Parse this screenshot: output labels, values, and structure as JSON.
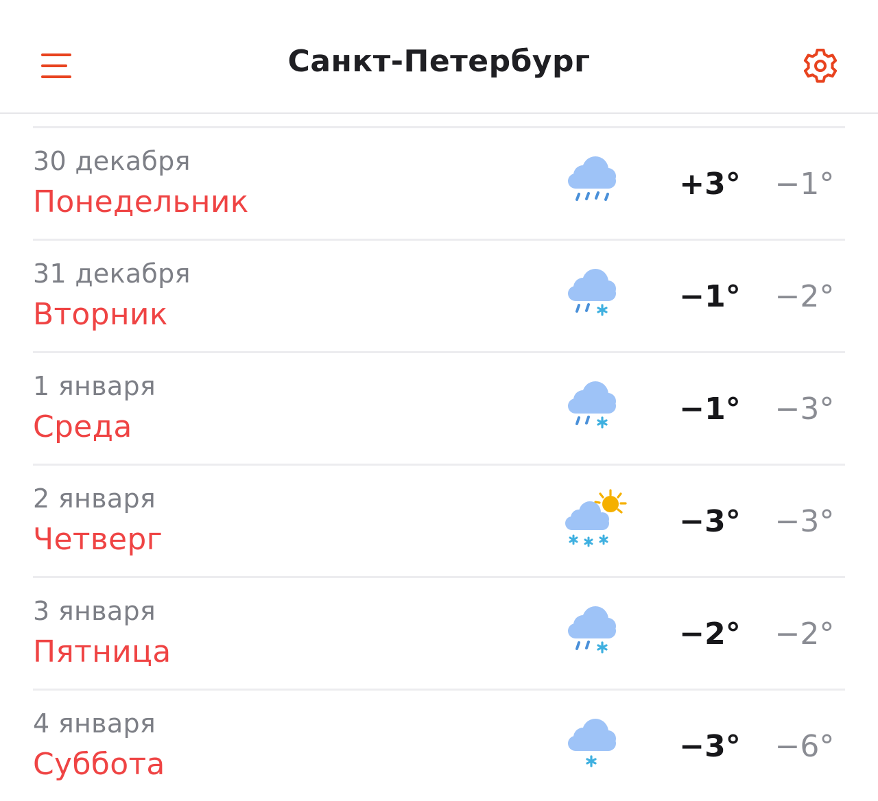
{
  "header": {
    "title": "Санкт-Петербург",
    "menu_icon": "hamburger-menu-icon",
    "settings_icon": "gear-icon",
    "accent_color": "#e8431f"
  },
  "forecast": [
    {
      "date": "30 декабря",
      "weekday": "Понедельник",
      "icon": "cloud-rain-icon",
      "day_temp": "+3°",
      "night_temp": "−1°"
    },
    {
      "date": "31 декабря",
      "weekday": "Вторник",
      "icon": "cloud-rain-snow-icon",
      "day_temp": "−1°",
      "night_temp": "−2°"
    },
    {
      "date": "1 января",
      "weekday": "Среда",
      "icon": "cloud-rain-snow-icon",
      "day_temp": "−1°",
      "night_temp": "−3°"
    },
    {
      "date": "2 января",
      "weekday": "Четверг",
      "icon": "sun-cloud-snow-icon",
      "day_temp": "−3°",
      "night_temp": "−3°"
    },
    {
      "date": "3 января",
      "weekday": "Пятница",
      "icon": "cloud-rain-snow-icon",
      "day_temp": "−2°",
      "night_temp": "−2°"
    },
    {
      "date": "4 января",
      "weekday": "Суббота",
      "icon": "cloud-snow-icon",
      "day_temp": "−3°",
      "night_temp": "−6°"
    }
  ],
  "colors": {
    "weekday": "#ef4444",
    "date": "#7d7f86",
    "day_temp": "#17171a",
    "night_temp": "#8a8c93",
    "cloud": "#9ec3f7",
    "drop": "#4a90d9",
    "snow": "#3fb0e0",
    "sun": "#f5b000"
  }
}
